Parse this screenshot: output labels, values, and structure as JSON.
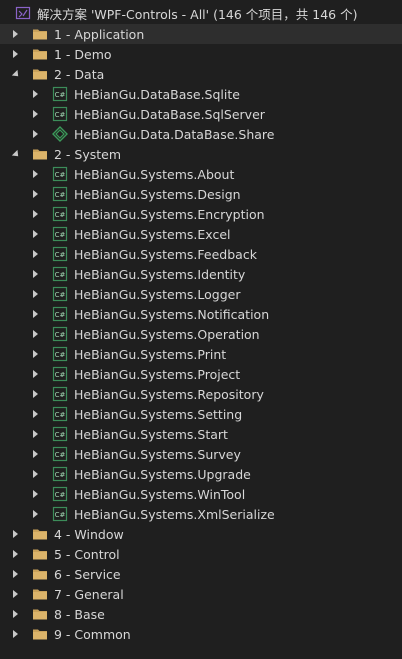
{
  "solution": {
    "label": "解决方案 'WPF-Controls - All' (146 个项目，共 146 个)"
  },
  "nodes": [
    {
      "level": 0,
      "type": "folder",
      "exp": "collapsed",
      "label": "1 - Application",
      "selected": true
    },
    {
      "level": 0,
      "type": "folder",
      "exp": "collapsed",
      "label": "1 - Demo"
    },
    {
      "level": 0,
      "type": "folder",
      "exp": "expanded",
      "label": "2 - Data"
    },
    {
      "level": 1,
      "type": "csproj",
      "exp": "collapsed",
      "label": "HeBianGu.DataBase.Sqlite"
    },
    {
      "level": 1,
      "type": "csproj",
      "exp": "collapsed",
      "label": "HeBianGu.DataBase.SqlServer"
    },
    {
      "level": 1,
      "type": "shared",
      "exp": "collapsed",
      "label": "HeBianGu.Data.DataBase.Share"
    },
    {
      "level": 0,
      "type": "folder",
      "exp": "expanded",
      "label": "2 - System"
    },
    {
      "level": 1,
      "type": "csproj",
      "exp": "collapsed",
      "label": "HeBianGu.Systems.About"
    },
    {
      "level": 1,
      "type": "csproj",
      "exp": "collapsed",
      "label": "HeBianGu.Systems.Design"
    },
    {
      "level": 1,
      "type": "csproj",
      "exp": "collapsed",
      "label": "HeBianGu.Systems.Encryption"
    },
    {
      "level": 1,
      "type": "csproj",
      "exp": "collapsed",
      "label": "HeBianGu.Systems.Excel"
    },
    {
      "level": 1,
      "type": "csproj",
      "exp": "collapsed",
      "label": "HeBianGu.Systems.Feedback"
    },
    {
      "level": 1,
      "type": "csproj",
      "exp": "collapsed",
      "label": "HeBianGu.Systems.Identity"
    },
    {
      "level": 1,
      "type": "csproj",
      "exp": "collapsed",
      "label": "HeBianGu.Systems.Logger"
    },
    {
      "level": 1,
      "type": "csproj",
      "exp": "collapsed",
      "label": "HeBianGu.Systems.Notification"
    },
    {
      "level": 1,
      "type": "csproj",
      "exp": "collapsed",
      "label": "HeBianGu.Systems.Operation"
    },
    {
      "level": 1,
      "type": "csproj",
      "exp": "collapsed",
      "label": "HeBianGu.Systems.Print"
    },
    {
      "level": 1,
      "type": "csproj",
      "exp": "collapsed",
      "label": "HeBianGu.Systems.Project"
    },
    {
      "level": 1,
      "type": "csproj",
      "exp": "collapsed",
      "label": "HeBianGu.Systems.Repository"
    },
    {
      "level": 1,
      "type": "csproj",
      "exp": "collapsed",
      "label": "HeBianGu.Systems.Setting"
    },
    {
      "level": 1,
      "type": "csproj",
      "exp": "collapsed",
      "label": "HeBianGu.Systems.Start"
    },
    {
      "level": 1,
      "type": "csproj",
      "exp": "collapsed",
      "label": "HeBianGu.Systems.Survey"
    },
    {
      "level": 1,
      "type": "csproj",
      "exp": "collapsed",
      "label": "HeBianGu.Systems.Upgrade"
    },
    {
      "level": 1,
      "type": "csproj",
      "exp": "collapsed",
      "label": "HeBianGu.Systems.WinTool"
    },
    {
      "level": 1,
      "type": "csproj",
      "exp": "collapsed",
      "label": "HeBianGu.Systems.XmlSerialize"
    },
    {
      "level": 0,
      "type": "folder",
      "exp": "collapsed",
      "label": "4 - Window"
    },
    {
      "level": 0,
      "type": "folder",
      "exp": "collapsed",
      "label": "5 - Control"
    },
    {
      "level": 0,
      "type": "folder",
      "exp": "collapsed",
      "label": "6 - Service"
    },
    {
      "level": 0,
      "type": "folder",
      "exp": "collapsed",
      "label": "7 - General"
    },
    {
      "level": 0,
      "type": "folder",
      "exp": "collapsed",
      "label": "8 - Base"
    },
    {
      "level": 0,
      "type": "folder",
      "exp": "collapsed",
      "label": "9 - Common"
    }
  ],
  "colors": {
    "background": "#1f1f1f",
    "selected_row": "#2e2e2e",
    "folder": "#c9a15a",
    "csproj_icon": "#3c8c5a",
    "shared_icon": "#3c9a5a",
    "solution_icon": "#8a63c8"
  }
}
